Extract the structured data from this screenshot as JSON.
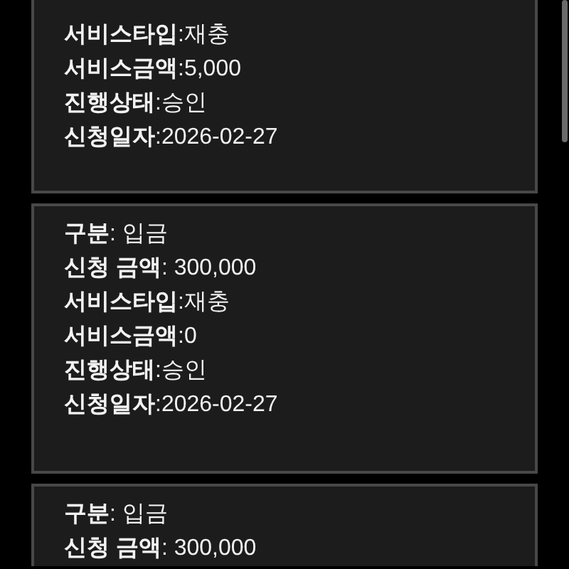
{
  "cards": [
    {
      "rows": [
        "**서비스타입**:재충",
        "**서비스금액**:5,000",
        "**진행상태**:승인",
        "**신청일자**:2026-02-27"
      ]
    },
    {
      "rows": [
        "**구분**: 입금",
        "**신청 금액**: 300,000",
        "**서비스타입**:재충",
        "**서비스금액**:0",
        "**진행상태**:승인",
        "**신청일자**:2026-02-27"
      ]
    },
    {
      "rows": [
        "**구분**: 입금",
        "**신청 금액**: 300,000"
      ]
    }
  ]
}
